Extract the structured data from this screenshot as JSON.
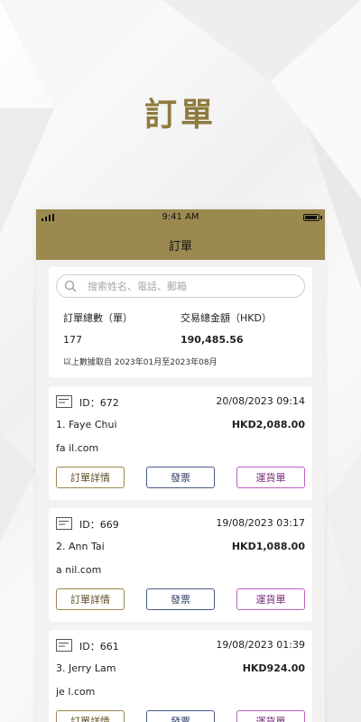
{
  "hero_title": "訂單",
  "phone": {
    "status_time": "9:41 AM",
    "header_title": "訂單"
  },
  "search": {
    "placeholder": "搜索姓名、電話、郵箱"
  },
  "summary": {
    "orders_label": "訂單總數（單）",
    "amount_label": "交易總金額（HKD）",
    "orders_value": "177",
    "amount_value": "190,485.56",
    "note": "以上數據取自 2023年01月至2023年08月"
  },
  "orders": [
    {
      "id": "ID：672",
      "time": "20/08/2023 09:14",
      "name": "1. Faye Chui",
      "amount": "HKD2,088.00",
      "email": "fa          il.com",
      "btn_detail": "訂單詳情",
      "btn_invoice": "發票",
      "btn_ship": "運貨單"
    },
    {
      "id": "ID：669",
      "time": "19/08/2023 03:17",
      "name": "2. Ann Tai",
      "amount": "HKD1,088.00",
      "email": "a          nil.com",
      "btn_detail": "訂單詳情",
      "btn_invoice": "發票",
      "btn_ship": "運貨單"
    },
    {
      "id": "ID：661",
      "time": "19/08/2023 01:39",
      "name": "3. Jerry Lam",
      "amount": "HKD924.00",
      "email": "je          l.com",
      "btn_detail": "訂單詳情",
      "btn_invoice": "發票",
      "btn_ship": "運貨單"
    }
  ],
  "colors": {
    "gold": "#9b8a4f",
    "hero_gold": "#8f7b3f",
    "invoice_blue": "#4a5a8a",
    "ship_purple": "#c060c0"
  },
  "icons": {
    "search": "search-icon",
    "order": "document-icon",
    "signal": "signal-icon",
    "battery": "battery-icon"
  }
}
